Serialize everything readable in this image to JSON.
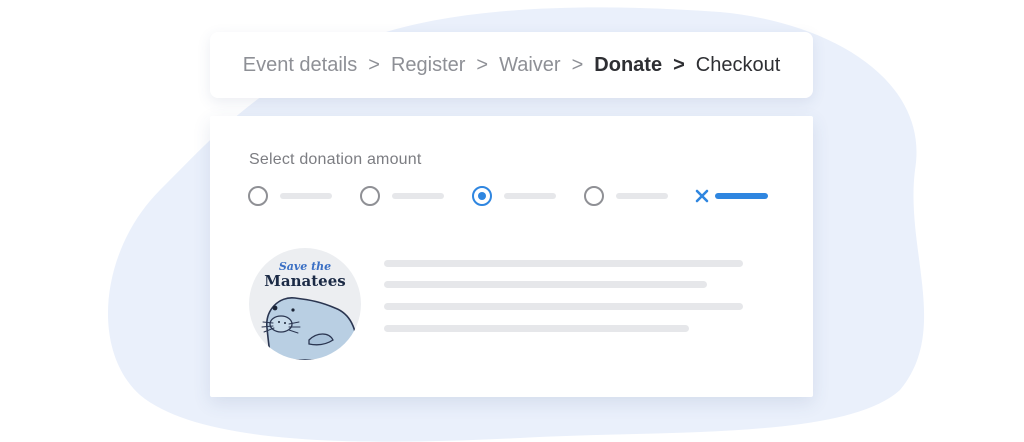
{
  "breadcrumb": {
    "steps": [
      {
        "label": "Event details",
        "state": "done"
      },
      {
        "label": "Register",
        "state": "done"
      },
      {
        "label": "Waiver",
        "state": "done"
      },
      {
        "label": "Donate",
        "state": "current"
      },
      {
        "label": "Checkout",
        "state": "next"
      }
    ],
    "separator": ">"
  },
  "donation": {
    "title": "Select donation amount",
    "options": [
      {
        "selected": false
      },
      {
        "selected": false
      },
      {
        "selected": true
      },
      {
        "selected": false
      },
      {
        "kind": "custom",
        "icon": "close-icon"
      }
    ]
  },
  "cause": {
    "logo_line1": "Save the",
    "logo_line2": "Manatees",
    "logo_icon": "manatee-icon"
  },
  "colors": {
    "accent": "#2f86e0",
    "text_dark": "#2e2f33",
    "text_muted": "#8e9096",
    "placeholder": "#e6e7ea",
    "backdrop": "#eaf0fb"
  }
}
